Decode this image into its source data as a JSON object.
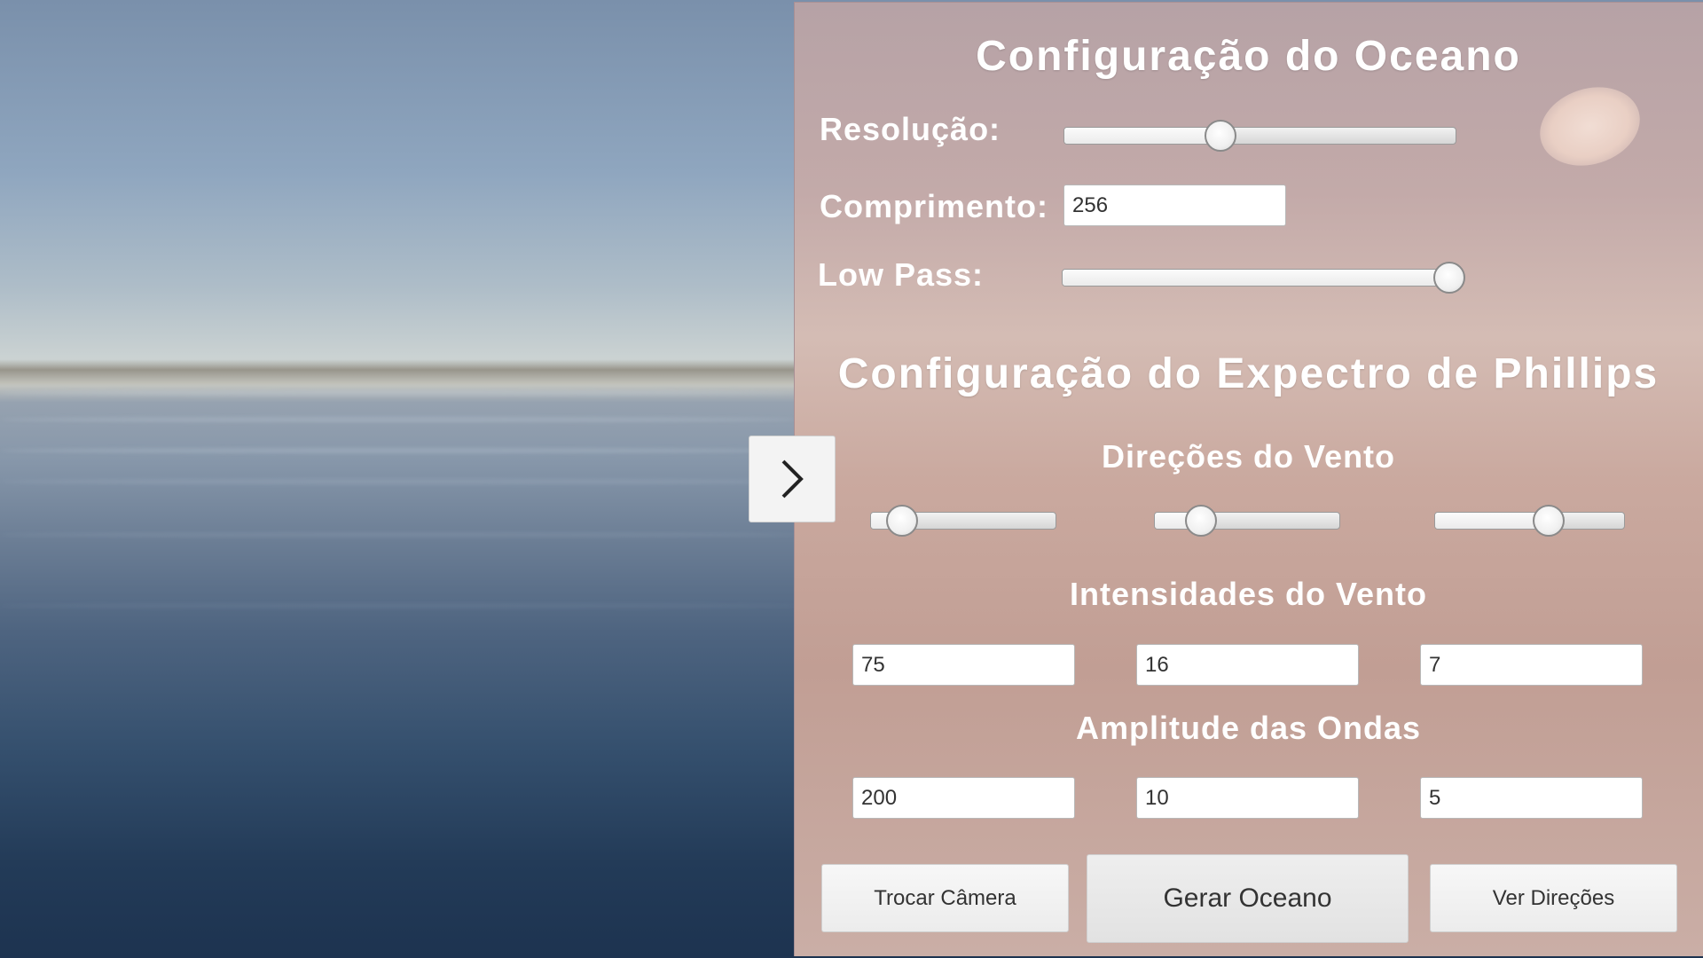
{
  "ocean": {
    "title": "Configuração do Oceano",
    "resolucao_label": "Resolução:",
    "resolucao_value": 0.4,
    "comprimento_label": "Comprimento:",
    "comprimento_value": "256",
    "lowpass_label": "Low Pass:",
    "lowpass_value": 0.97
  },
  "spectrum": {
    "title": "Configuração do Expectro de Phillips",
    "direcoes_label": "Direções do Vento",
    "direcoes_values": [
      0.17,
      0.25,
      0.6
    ],
    "intensidades_label": "Intensidades do Vento",
    "intensidades": [
      "75",
      "16",
      "7"
    ],
    "amplitude_label": "Amplitude das Ondas",
    "amplitudes": [
      "200",
      "10",
      "5"
    ]
  },
  "buttons": {
    "trocar_camera": "Trocar Câmera",
    "gerar_oceano": "Gerar Oceano",
    "ver_direcoes": "Ver Direções"
  },
  "icons": {
    "toggle": "chevron-right-icon"
  }
}
